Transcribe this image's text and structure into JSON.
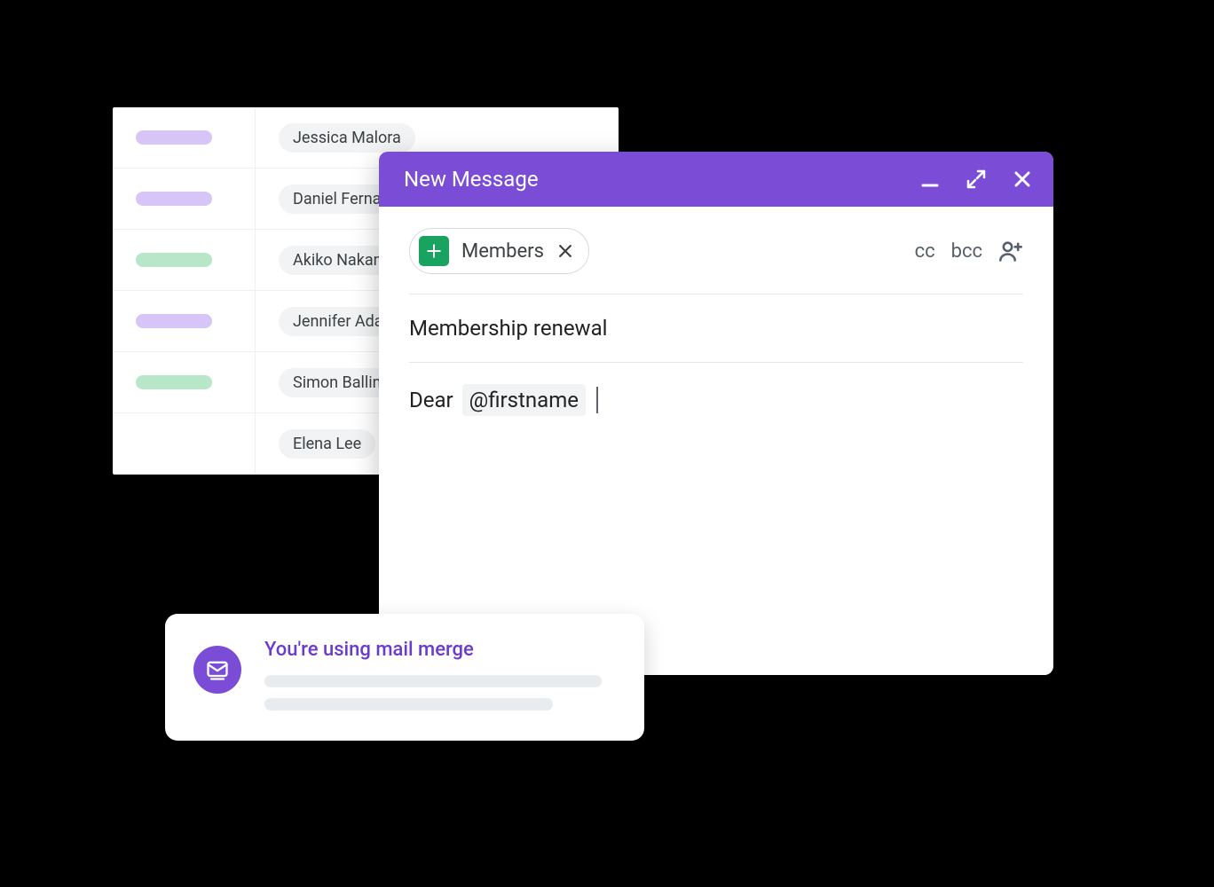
{
  "spreadsheet": {
    "rows": [
      {
        "tag_color": "purple",
        "name": "Jessica Malora"
      },
      {
        "tag_color": "purple",
        "name": "Daniel Fernandez"
      },
      {
        "tag_color": "green",
        "name": "Akiko Nakamura"
      },
      {
        "tag_color": "purple",
        "name": "Jennifer Adams"
      },
      {
        "tag_color": "green",
        "name": "Simon Ballinger"
      },
      {
        "tag_color": "",
        "name": "Elena Lee"
      }
    ]
  },
  "compose": {
    "window_title": "New Message",
    "to_chip": {
      "label": "Members",
      "source_icon": "sheets-icon"
    },
    "cc_label": "cc",
    "bcc_label": "bcc",
    "subject": "Membership renewal",
    "body_prefix": "Dear",
    "merge_token": "@firstname"
  },
  "notification": {
    "title": "You're using mail merge"
  },
  "colors": {
    "accent": "#7b4dd6",
    "sheets_green": "#1aa260",
    "tag_purple": "#d7c5f7",
    "tag_green": "#b8e6c8"
  }
}
